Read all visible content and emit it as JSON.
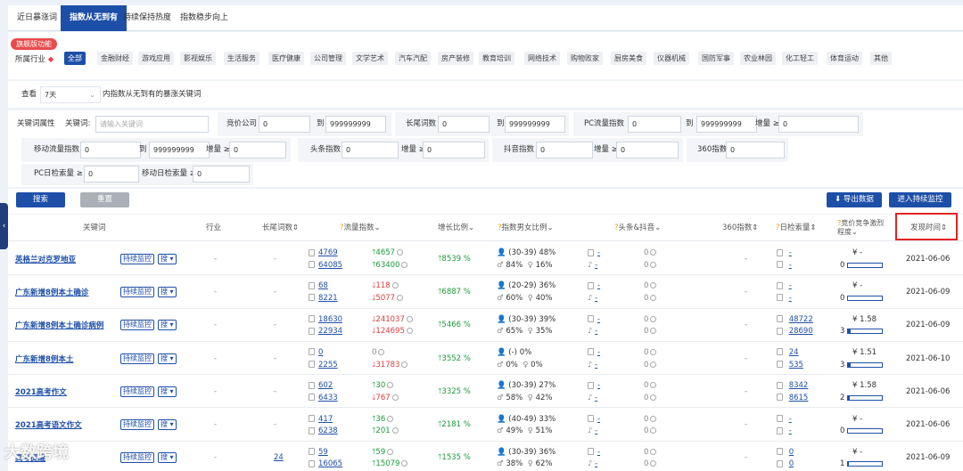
{
  "tabs": [
    "近日暴涨词",
    "指数从无到有",
    "持续保持热度",
    "指数稳步向上"
  ],
  "vip_badge": "旗舰版功能",
  "industry_label": "所属行业",
  "industries": [
    "全部",
    "金融财经",
    "游戏应用",
    "影视娱乐",
    "生活服务",
    "医疗健康",
    "公司管理",
    "文学艺术",
    "汽车汽配",
    "房产装修",
    "教育培训",
    "网络技术",
    "购物败家",
    "厨房美食",
    "仪器机械",
    "国防军事",
    "农业林园",
    "化工轻工",
    "体育运动",
    "其他"
  ],
  "period": {
    "label": "查看",
    "value": "7天",
    "suffix": "内指数从无到有的暴涨关键词"
  },
  "filters": {
    "attr_label": "关键词属性",
    "keyword_label": "关键词:",
    "keyword_placeholder": "请输入关键词",
    "bid_label": "竞价公司",
    "bid_from": "0",
    "to": "到",
    "bid_to": "999999999",
    "longtail_label": "长尾词数",
    "lt_from": "0",
    "lt_to": "999999999",
    "pc_label": "PC流量指数",
    "pc_from": "0",
    "pc_to": "999999999",
    "inc_label": "增量 ≥",
    "pc_inc": "0",
    "mobile_label": "移动流量指数",
    "mob_from": "0",
    "mob_to": "999999999",
    "mob_inc": "0",
    "toutiao_label": "头条指数",
    "tt_val": "0",
    "tt_inc": "0",
    "douyin_label": "抖音指数",
    "dy_val": "0",
    "dy_inc": "0",
    "s360_label": "360指数",
    "s360_val": "0",
    "pcday_label": "PC日检索量 ≥",
    "pcday_val": "0",
    "mday_label": "移动日检索量 ≥",
    "mday_val": "0"
  },
  "buttons": {
    "search": "搜索",
    "reset": "重置",
    "export": "导出数据",
    "monitor": "进入持续监控"
  },
  "headers": {
    "keyword": "关键词",
    "industry": "行业",
    "longtail": "长尾词数",
    "flow": "流量指数",
    "growth": "增长比例",
    "gender": "指数男女比例",
    "tt_dy": "头条&抖音",
    "s360": "360指数",
    "daily": "日检索量",
    "bid": "竞价竞争激烈程度",
    "time": "发现时间"
  },
  "row_buttons": {
    "monitor": "持续监控",
    "search": "搜"
  },
  "rows": [
    {
      "kw": "英格兰对克罗地亚",
      "industry": "-",
      "longtail": "-",
      "f1": "4769",
      "f2": "64085",
      "d1": "4657",
      "d2": "63400",
      "d1dir": "up",
      "d2dir": "up",
      "growth": "8539 %",
      "age": "(30-39)",
      "agep": "48%",
      "male": "84%",
      "female": "16%",
      "tt": "-",
      "dy": "-",
      "ttc": "0",
      "dyc": "0",
      "s360": "-",
      "daily1": "-",
      "daily2": "-",
      "price": "¥ -",
      "bidn": "0",
      "bidp": 0,
      "time": "2021-06-06"
    },
    {
      "kw": "广东新增8例本土确诊",
      "industry": "-",
      "longtail": "-",
      "f1": "68",
      "f2": "8221",
      "d1": "118",
      "d2": "5077",
      "d1dir": "dn",
      "d2dir": "dn",
      "growth": "6887 %",
      "age": "(20-29)",
      "agep": "36%",
      "male": "60%",
      "female": "40%",
      "tt": "-",
      "dy": "-",
      "ttc": "0",
      "dyc": "0",
      "s360": "-",
      "daily1": "-",
      "daily2": "-",
      "price": "¥ -",
      "bidn": "0",
      "bidp": 0,
      "time": "2021-06-09"
    },
    {
      "kw": "广东新增8例本土确诊病例",
      "industry": "-",
      "longtail": "-",
      "f1": "18630",
      "f2": "22934",
      "d1": "241037",
      "d2": "124695",
      "d1dir": "dn",
      "d2dir": "dn",
      "growth": "5466 %",
      "age": "(30-39)",
      "agep": "39%",
      "male": "65%",
      "female": "35%",
      "tt": "-",
      "dy": "-",
      "ttc": "0",
      "dyc": "0",
      "s360": "-",
      "daily1": "48722",
      "daily2": "28690",
      "price": "¥ 1.58",
      "bidn": "3",
      "bidp": 0.08,
      "time": "2021-06-09"
    },
    {
      "kw": "广东新增8例本土",
      "industry": "-",
      "longtail": "-",
      "f1": "0",
      "f2": "2255",
      "d1": "0",
      "d2": "31783",
      "d1dir": "none",
      "d2dir": "dn",
      "growth": "3552 %",
      "age": "(-)",
      "agep": "0%",
      "male": "0%",
      "female": "0%",
      "tt": "-",
      "dy": "-",
      "ttc": "0",
      "dyc": "0",
      "s360": "-",
      "daily1": "24",
      "daily2": "535",
      "price": "¥ 1.51",
      "bidn": "3",
      "bidp": 0.08,
      "time": "2021-06-10"
    },
    {
      "kw": "2021高考作文",
      "industry": "-",
      "longtail": "-",
      "f1": "602",
      "f2": "6433",
      "d1": "30",
      "d2": "767",
      "d1dir": "up",
      "d2dir": "dn",
      "growth": "3325 %",
      "age": "(30-39)",
      "agep": "27%",
      "male": "58%",
      "female": "42%",
      "tt": "-",
      "dy": "-",
      "ttc": "0",
      "dyc": "0",
      "s360": "-",
      "daily1": "8342",
      "daily2": "8615",
      "price": "¥ 1.58",
      "bidn": "2",
      "bidp": 0.06,
      "time": "2021-06-06"
    },
    {
      "kw": "2021高考语文作文",
      "industry": "-",
      "longtail": "-",
      "f1": "417",
      "f2": "6238",
      "d1": "36",
      "d2": "201",
      "d1dir": "up",
      "d2dir": "up",
      "growth": "2181 %",
      "age": "(40-49)",
      "agep": "33%",
      "male": "49%",
      "female": "51%",
      "tt": "-",
      "dy": "-",
      "ttc": "0",
      "dyc": "0",
      "s360": "-",
      "daily1": "-",
      "daily2": "-",
      "price": "¥ -",
      "bidn": "0",
      "bidp": 0,
      "time": "2021-06-06"
    },
    {
      "kw": "高考提醒",
      "industry": "-",
      "longtail": "24",
      "f1": "59",
      "f2": "16065",
      "d1": "59",
      "d2": "15079",
      "d1dir": "up",
      "d2dir": "up",
      "growth": "1535 %",
      "age": "(30-39)",
      "agep": "36%",
      "male": "38%",
      "female": "62%",
      "tt": "-",
      "dy": "-",
      "ttc": "0",
      "dyc": "0",
      "s360": "-",
      "daily1": "0",
      "daily2": "0",
      "price": "¥ -",
      "bidn": "1",
      "bidp": 0.03,
      "time": "2021-06-09"
    }
  ],
  "watermark": "大数跨境",
  "colors": {
    "primary": "#1e4fa8",
    "up": "#1a9b3a",
    "down": "#e23b3b",
    "highlight": "#e02424"
  }
}
